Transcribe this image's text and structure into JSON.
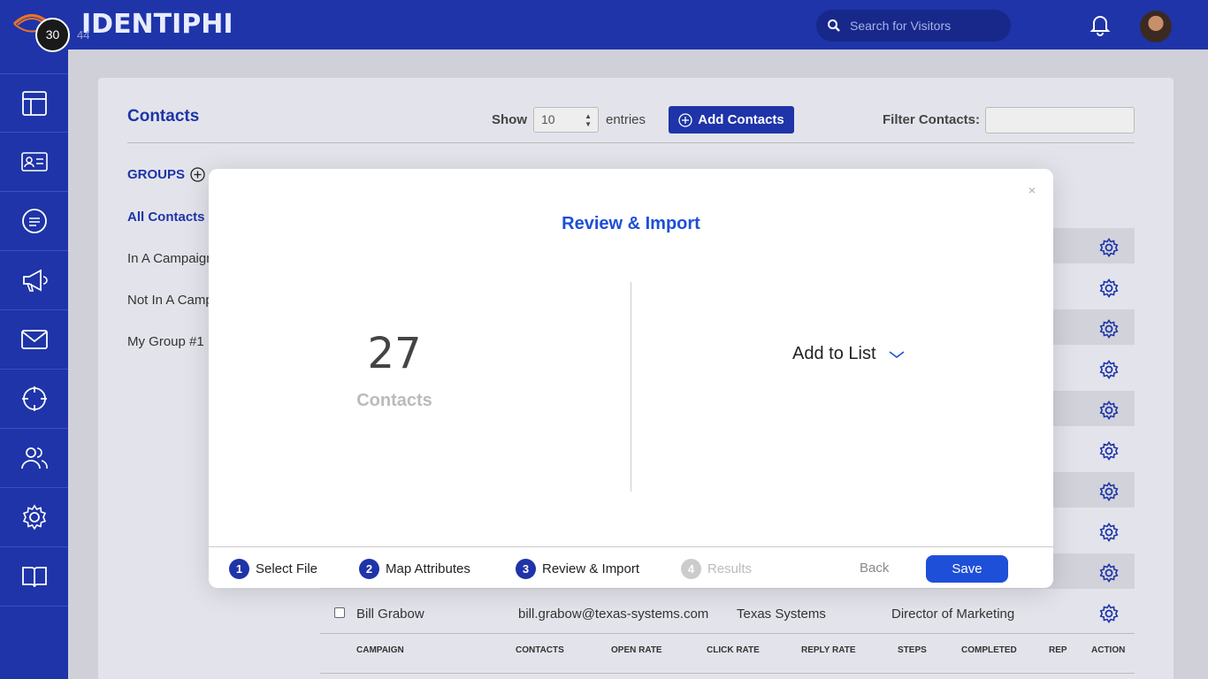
{
  "header": {
    "logo_text": "IDENTIPHI",
    "timer_value": "30",
    "timer_sub": "44",
    "search_placeholder": "Search for Visitors"
  },
  "sidebar": {
    "items": [
      {
        "icon": "dashboard-icon"
      },
      {
        "icon": "contact-card-icon"
      },
      {
        "icon": "chat-icon"
      },
      {
        "icon": "megaphone-icon"
      },
      {
        "icon": "mail-icon"
      },
      {
        "icon": "target-icon"
      },
      {
        "icon": "users-icon"
      },
      {
        "icon": "settings-icon"
      },
      {
        "icon": "book-icon"
      }
    ]
  },
  "contacts_page": {
    "title": "Contacts",
    "show_label": "Show",
    "entries_value": "10",
    "entries_label": "entries",
    "add_contacts_label": "Add Contacts",
    "filter_label": "Filter Contacts:",
    "groups_label": "GROUPS",
    "groups": [
      "All Contacts",
      "In A Campaign",
      "Not In A Campaign",
      "My Group #1"
    ],
    "bill_row": {
      "name": "Bill Grabow",
      "email": "bill.grabow@texas-systems.com",
      "company": "Texas Systems",
      "title": "Director of Marketing"
    },
    "campaign_headers": [
      "CAMPAIGN",
      "CONTACTS",
      "OPEN RATE",
      "CLICK RATE",
      "REPLY RATE",
      "STEPS",
      "COMPLETED",
      "REP",
      "ACTION"
    ]
  },
  "modal": {
    "close_label": "×",
    "title": "Review & Import",
    "count": "27",
    "count_label": "Contacts",
    "add_to_list_label": "Add to List",
    "steps": [
      {
        "num": "1",
        "label": "Select File",
        "active": true
      },
      {
        "num": "2",
        "label": "Map Attributes",
        "active": true
      },
      {
        "num": "3",
        "label": "Review & Import",
        "active": true
      },
      {
        "num": "4",
        "label": "Results",
        "active": false
      }
    ],
    "back_label": "Back",
    "save_label": "Save"
  },
  "colors": {
    "brand_blue": "#1e34a8",
    "accent_blue": "#1e4fd8"
  }
}
